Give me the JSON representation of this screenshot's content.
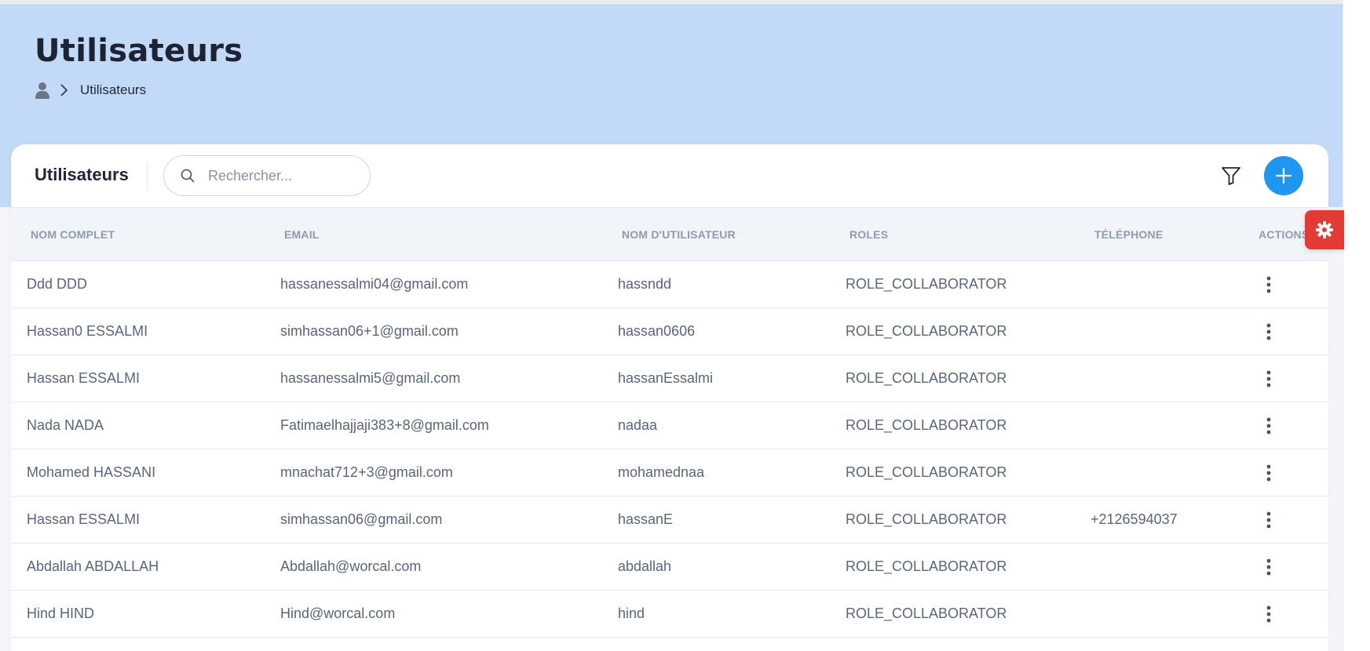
{
  "header": {
    "title": "Utilisateurs",
    "breadcrumb": [
      "Utilisateurs"
    ]
  },
  "card": {
    "title": "Utilisateurs",
    "search": {
      "placeholder": "Rechercher...",
      "value": ""
    },
    "icons": {
      "search": "search-icon",
      "filter": "filter-icon",
      "add": "plus-icon",
      "settings": "gear-icon"
    },
    "colors": {
      "hero": "#c3d9f8",
      "add_button": "#1f96f0",
      "settings_button": "#e33a36"
    }
  },
  "table": {
    "columns": [
      "NOM COMPLET",
      "EMAIL",
      "NOM D'UTILISATEUR",
      "ROLES",
      "TÉLÉPHONE",
      "ACTIONS"
    ],
    "rows": [
      {
        "name": "Ddd DDD",
        "email": "hassanessalmi04@gmail.com",
        "username": "hassndd",
        "role": "ROLE_COLLABORATOR",
        "phone": ""
      },
      {
        "name": "Hassan0 ESSALMI",
        "email": "simhassan06+1@gmail.com",
        "username": "hassan0606",
        "role": "ROLE_COLLABORATOR",
        "phone": ""
      },
      {
        "name": "Hassan ESSALMI",
        "email": "hassanessalmi5@gmail.com",
        "username": "hassanEssalmi",
        "role": "ROLE_COLLABORATOR",
        "phone": ""
      },
      {
        "name": "Nada NADA",
        "email": "Fatimaelhajjaji383+8@gmail.com",
        "username": "nadaa",
        "role": "ROLE_COLLABORATOR",
        "phone": ""
      },
      {
        "name": "Mohamed HASSANI",
        "email": "mnachat712+3@gmail.com",
        "username": "mohamednaa",
        "role": "ROLE_COLLABORATOR",
        "phone": ""
      },
      {
        "name": "Hassan ESSALMI",
        "email": "simhassan06@gmail.com",
        "username": "hassanE",
        "role": "ROLE_COLLABORATOR",
        "phone": "+2126594037"
      },
      {
        "name": "Abdallah ABDALLAH",
        "email": "Abdallah@worcal.com",
        "username": "abdallah",
        "role": "ROLE_COLLABORATOR",
        "phone": ""
      },
      {
        "name": "Hind HIND",
        "email": "Hind@worcal.com",
        "username": "hind",
        "role": "ROLE_COLLABORATOR",
        "phone": ""
      }
    ]
  }
}
